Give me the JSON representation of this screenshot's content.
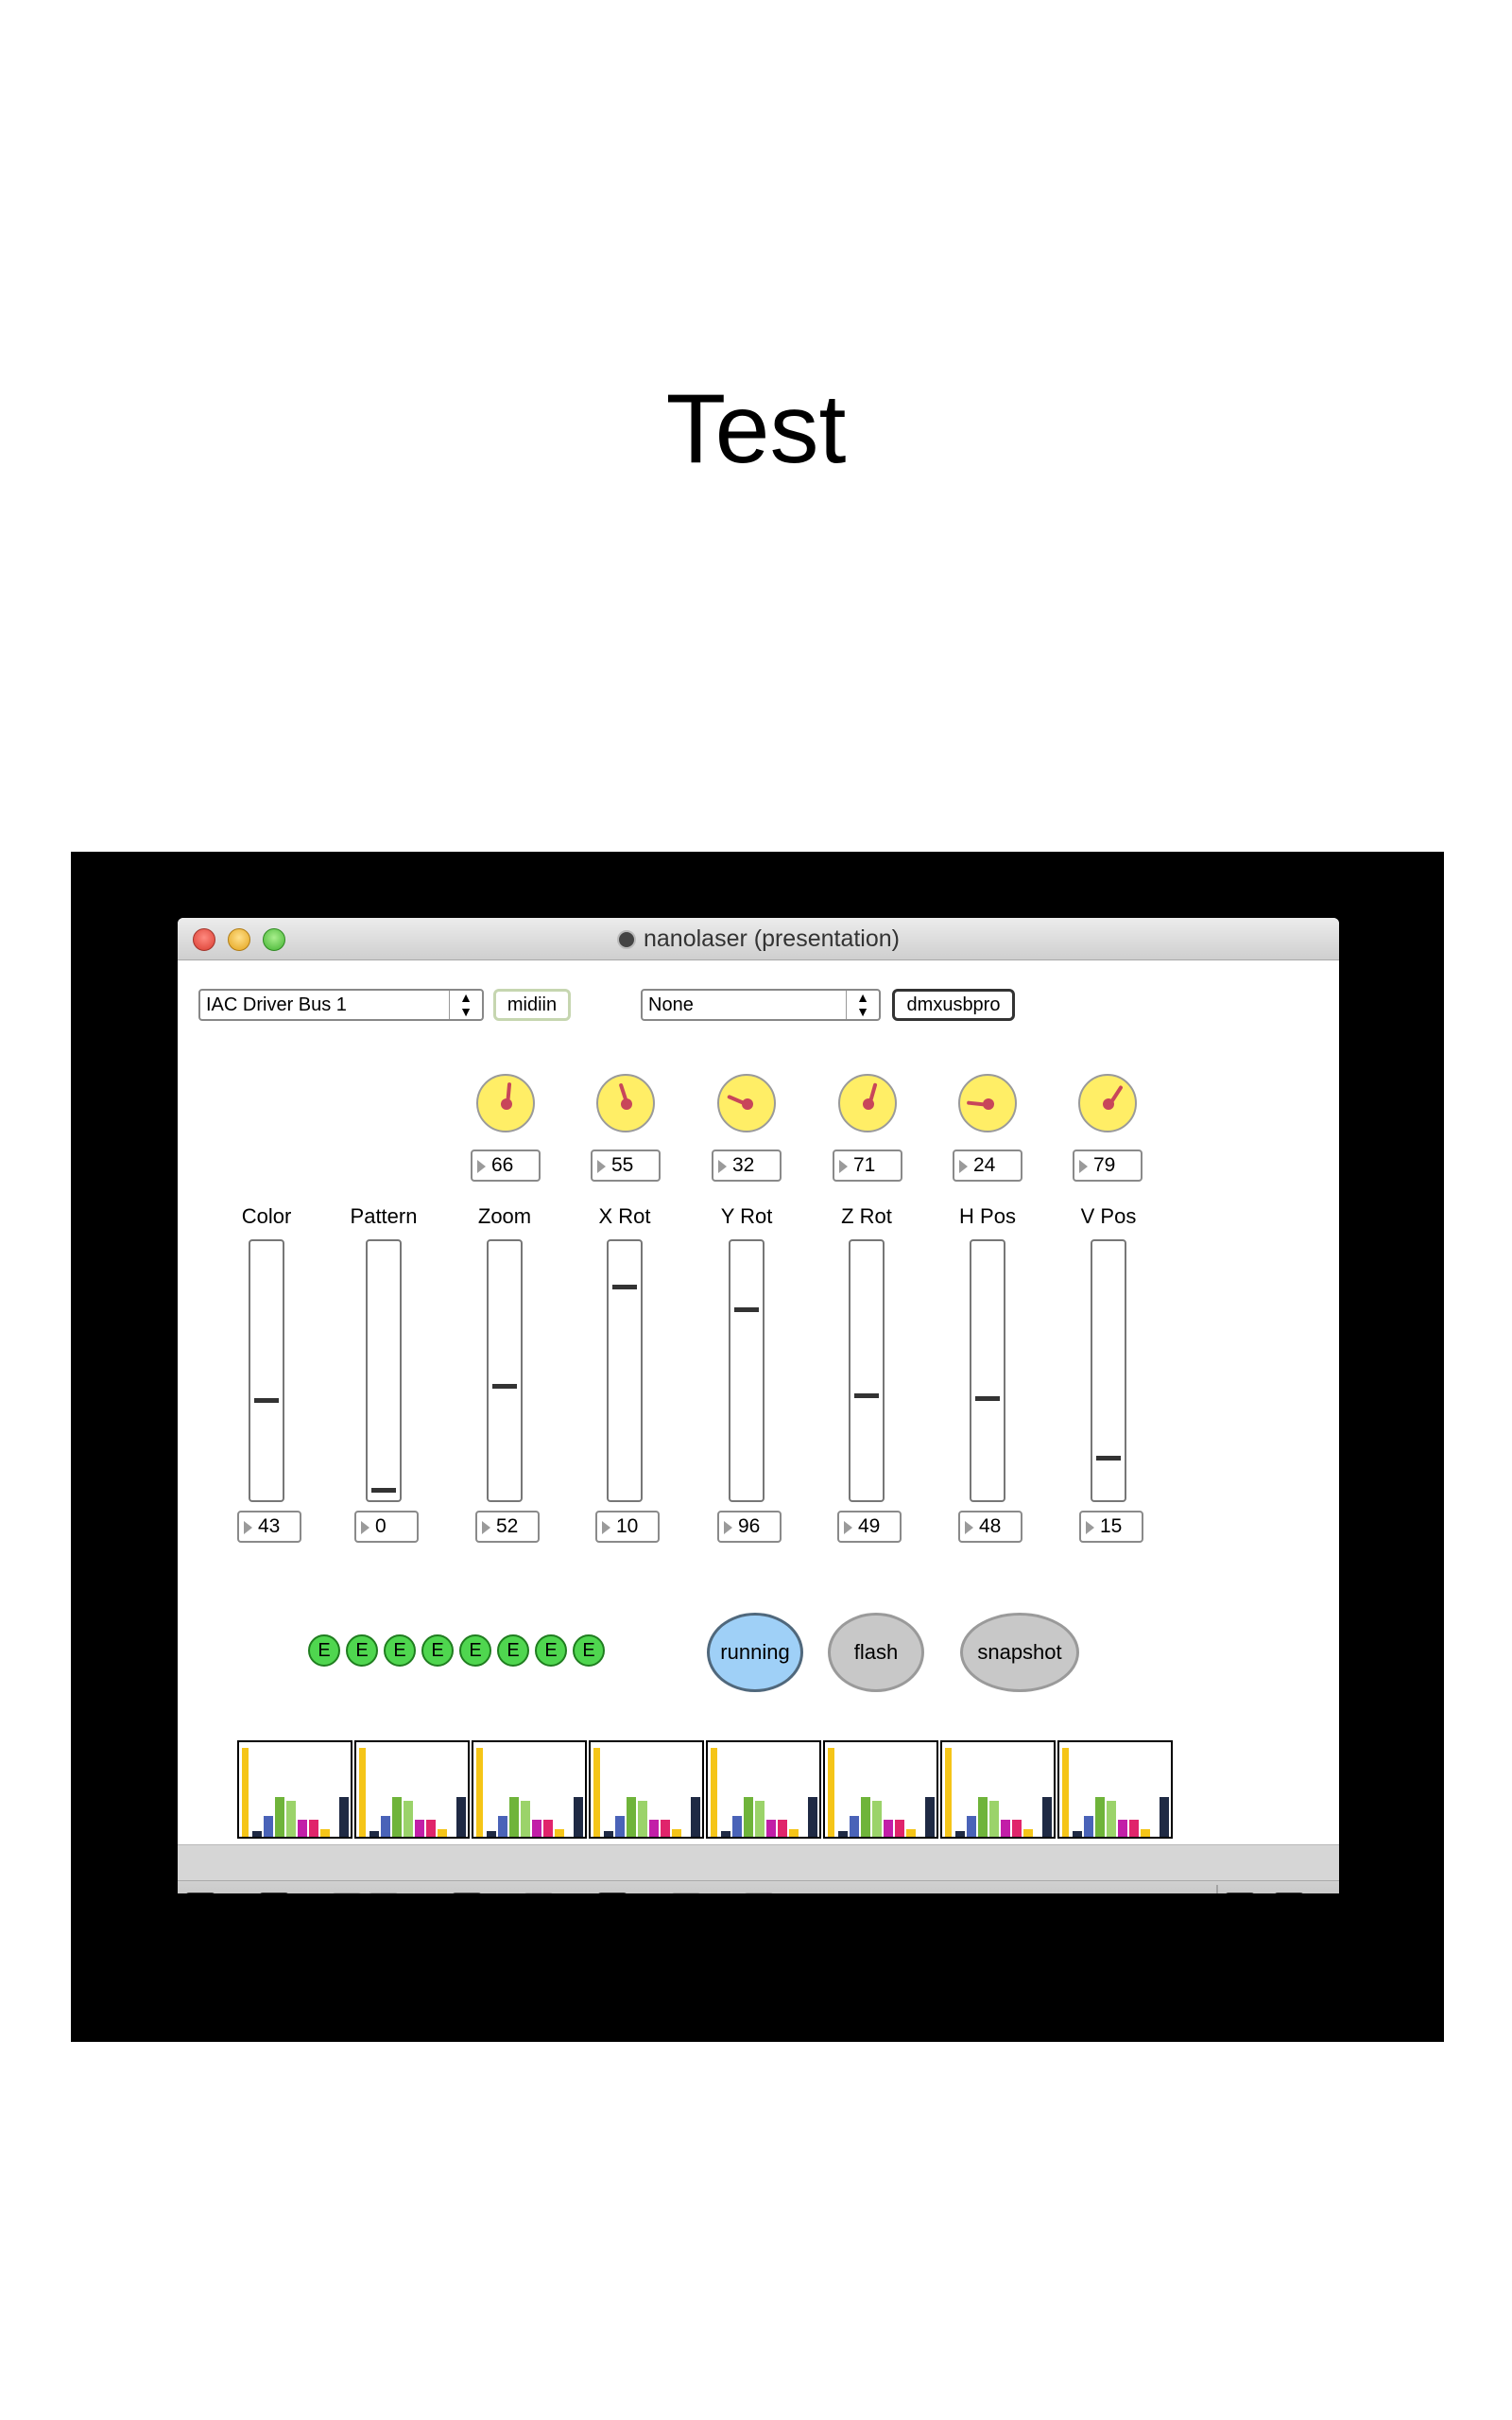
{
  "page": {
    "title": "Test"
  },
  "window": {
    "title": "nanolaser (presentation)",
    "midi_device": "IAC Driver Bus 1",
    "midi_object": "midiin",
    "dmx_device": "None",
    "dmx_object": "dmxusbpro"
  },
  "dials": [
    {
      "label": "Zoom",
      "value": "66"
    },
    {
      "label": "X Rot",
      "value": "55"
    },
    {
      "label": "Y Rot",
      "value": "32"
    },
    {
      "label": "Z Rot",
      "value": "71"
    },
    {
      "label": "H Pos",
      "value": "24"
    },
    {
      "label": "V Pos",
      "value": "79"
    }
  ],
  "sliders": [
    {
      "label": "Color",
      "value": "43",
      "level": 0.38
    },
    {
      "label": "Pattern",
      "value": "0",
      "level": 0.02
    },
    {
      "label": "Zoom",
      "value": "52",
      "level": 0.44
    },
    {
      "label": "X Rot",
      "value": "10",
      "level": 0.84
    },
    {
      "label": "Y Rot",
      "value": "96",
      "level": 0.75
    },
    {
      "label": "Z Rot",
      "value": "49",
      "level": 0.4
    },
    {
      "label": "H Pos",
      "value": "48",
      "level": 0.39
    },
    {
      "label": "V Pos",
      "value": "15",
      "level": 0.15
    }
  ],
  "e_buttons": [
    "E",
    "E",
    "E",
    "E",
    "E",
    "E",
    "E",
    "E"
  ],
  "buttons": {
    "running": "running",
    "flash": "flash",
    "snapshot": "snapshot"
  },
  "colors": {
    "dial_fill": "#ffee66",
    "dial_needle": "#c8465a",
    "running": "#9fd0f7",
    "e_button": "#4fd64f"
  },
  "toolbar_icons": [
    "lock-icon",
    "presentation-icon",
    "cords-icon",
    "delete-icon",
    "patch-icon",
    "info-icon",
    "inspector-icon",
    "grid-icon",
    "debug-icon",
    "split-view-icon",
    "single-view-icon"
  ]
}
